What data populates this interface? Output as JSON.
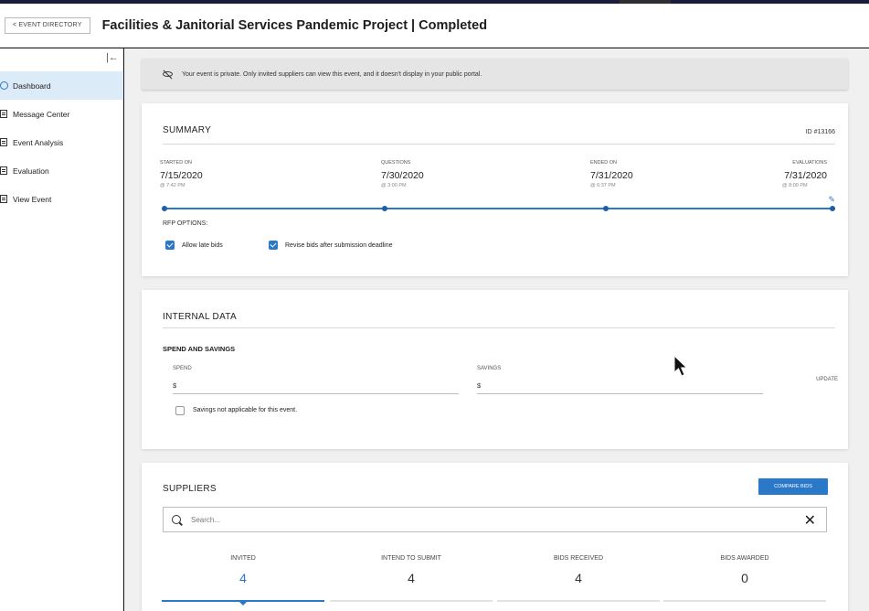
{
  "header": {
    "back_button": "< EVENT DIRECTORY",
    "title": "Facilities & Janitorial Services Pandemic Project | Completed"
  },
  "sidebar": {
    "collapse_icon": "collapse-sidebar-icon",
    "items": [
      {
        "label": "Dashboard",
        "icon": "circle-icon",
        "active": true
      },
      {
        "label": "Message Center",
        "icon": "message-icon"
      },
      {
        "label": "Event Analysis",
        "icon": "analysis-icon"
      },
      {
        "label": "Evaluation",
        "icon": "evaluation-icon"
      },
      {
        "label": "View Event",
        "icon": "document-icon"
      }
    ]
  },
  "privacy_banner": {
    "icon": "eye-off-icon",
    "text": "Your event is private. Only invited suppliers can view this event, and it doesn't display in your public portal."
  },
  "summary": {
    "title": "SUMMARY",
    "event_id": "ID #13166",
    "milestones": [
      {
        "label": "STARTED ON",
        "date": "7/15/2020",
        "time": "@ 7:42 PM"
      },
      {
        "label": "QUESTIONS",
        "date": "7/30/2020",
        "time": "@ 3:00 PM"
      },
      {
        "label": "ENDED ON",
        "date": "7/31/2020",
        "time": "@ 6:37 PM"
      },
      {
        "label": "EVALUATIONS",
        "date": "7/31/2020",
        "time": "@ 8:00 PM"
      }
    ],
    "rfp_label": "RFP OPTIONS:",
    "options": [
      {
        "label": "Allow late bids",
        "checked": true
      },
      {
        "label": "Revise bids after submission deadline",
        "checked": true
      }
    ]
  },
  "internal": {
    "title": "INTERNAL DATA",
    "subheading": "SPEND AND SAVINGS",
    "spend_label": "SPEND",
    "spend_value": "$",
    "savings_label": "SAVINGS",
    "savings_value": "$",
    "update_label": "UPDATE",
    "not_applicable": "Savings not applicable for this event."
  },
  "suppliers": {
    "title": "SUPPLIERS",
    "compare_label": "COMPARE BIDS",
    "search_placeholder": "Search...",
    "stats": [
      {
        "label": "INVITED",
        "value": "4",
        "active": true
      },
      {
        "label": "INTEND TO SUBMIT",
        "value": "4"
      },
      {
        "label": "BIDS RECEIVED",
        "value": "4"
      },
      {
        "label": "BIDS AWARDED",
        "value": "0"
      }
    ]
  },
  "colors": {
    "accent": "#2a78c8",
    "active_nav": "#dcebf8",
    "background": "#f0f0f0"
  }
}
